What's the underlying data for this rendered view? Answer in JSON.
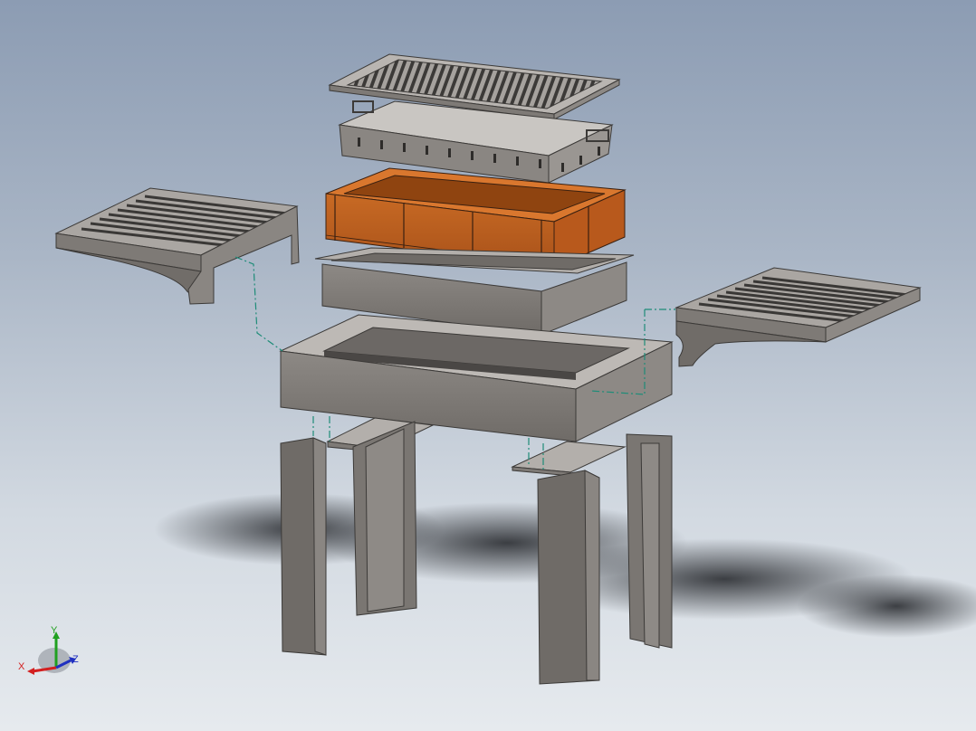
{
  "viewport": {
    "background_top": "#8c9cb3",
    "background_bottom": "#e6eaee"
  },
  "colors": {
    "metal": "#8a8682",
    "metal_light": "#b3afab",
    "metal_dark": "#5f5c59",
    "brick": "#c0601e",
    "brick_light": "#d9772e",
    "brick_dark": "#8f4410",
    "hidden_line": "#1e8c78",
    "shadow": "#2a2c30"
  },
  "triad": {
    "x_label": "X",
    "y_label": "Y",
    "z_label": "Z",
    "x_color": "#d32020",
    "y_color": "#20a020",
    "z_color": "#2030c0",
    "icon": "coordinate-triad-icon"
  }
}
